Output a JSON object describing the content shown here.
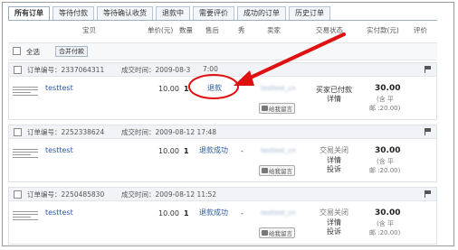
{
  "tabs": [
    "所有订单",
    "等待付款",
    "等待确认收货",
    "退款中",
    "需要评价",
    "成功的订单",
    "历史订单"
  ],
  "columns": {
    "item": "宝贝",
    "unit_price": "单价(元)",
    "qty": "数量",
    "after_sale": "售后",
    "show": "秀",
    "seller": "卖家",
    "status": "交易状态",
    "paid": "实付款(元)",
    "review": "评价"
  },
  "toolbar": {
    "select_all": "全选",
    "merge_pay": "合并付款"
  },
  "orders": [
    {
      "order_no_label": "订单编号：2337064311",
      "time_label": "成交时间：2009-08-3",
      "time_rest": "7:00",
      "title": "testtest",
      "price": "10.00",
      "qty": "1",
      "after_sale": "退款",
      "seller": "testtest_cn",
      "msg_btn": "给我留言",
      "status": "买家已付款",
      "actions": [
        "详情"
      ],
      "total": "30.00",
      "shipping_line1": "(含 平",
      "shipping_line2": "邮 :20.00)"
    },
    {
      "order_no_label": "订单编号：2252338624",
      "time_label": "成交时间：2009-08-12 17:48",
      "time_rest": "",
      "title": "testtest",
      "price": "10.00",
      "qty": "1",
      "after_sale": "退款成功",
      "show": "-",
      "seller": "testtest_cn",
      "msg_btn": "给我留言",
      "status": "交易关闭",
      "actions": [
        "详情",
        "投诉"
      ],
      "total": "30.00",
      "shipping_line1": "(含 平",
      "shipping_line2": "邮 :20.00)"
    },
    {
      "order_no_label": "订单编号：2250485830",
      "time_label": "成交时间：2009-08-12 11:52",
      "time_rest": "",
      "title": "testtest",
      "price": "10.00",
      "qty": "1",
      "after_sale": "退款成功",
      "show": "-",
      "seller": "testtest_cn",
      "msg_btn": "给我留言",
      "status": "交易关闭",
      "actions": [
        "详情",
        "投诉"
      ],
      "total": "30.00",
      "shipping_line1": "(含 平",
      "shipping_line2": "邮 :20.00)"
    }
  ],
  "colors": {
    "link": "#2a5a9c",
    "annotation": "#e01010",
    "tab_border": "#9bb0c8"
  }
}
